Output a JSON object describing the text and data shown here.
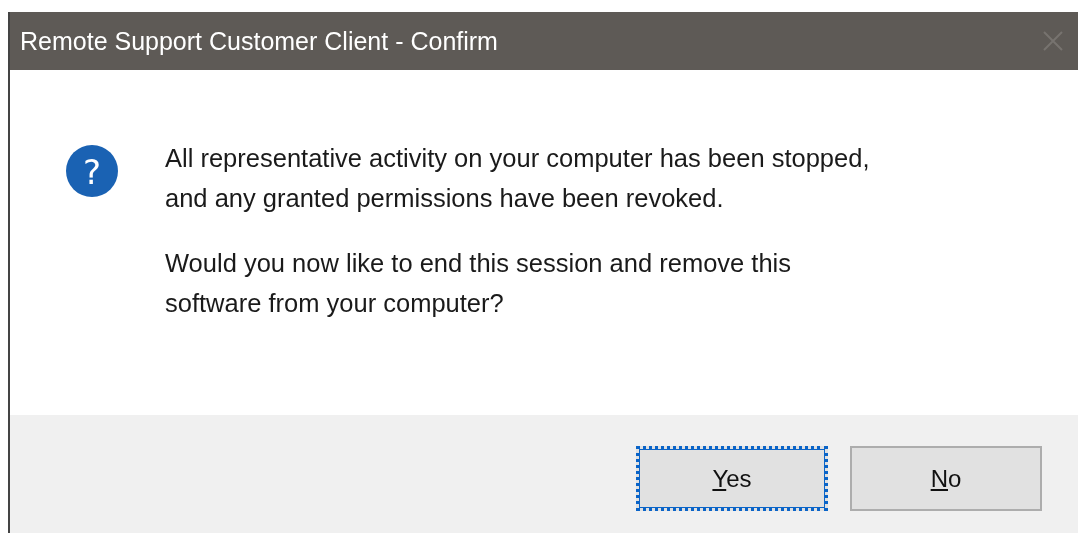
{
  "window": {
    "title": "Remote Support Customer Client - Confirm"
  },
  "message": {
    "kind": "question",
    "icon_glyph": "?",
    "paragraphs": [
      "All representative activity on your computer has been stopped,\nand any granted permissions have been revoked.",
      "Would you now like to end this session and remove this\nsoftware from your computer?"
    ]
  },
  "buttons": [
    {
      "label": "Yes",
      "focused": true,
      "mnemonic": true
    },
    {
      "label": "No",
      "focused": false,
      "mnemonic": true
    }
  ]
}
